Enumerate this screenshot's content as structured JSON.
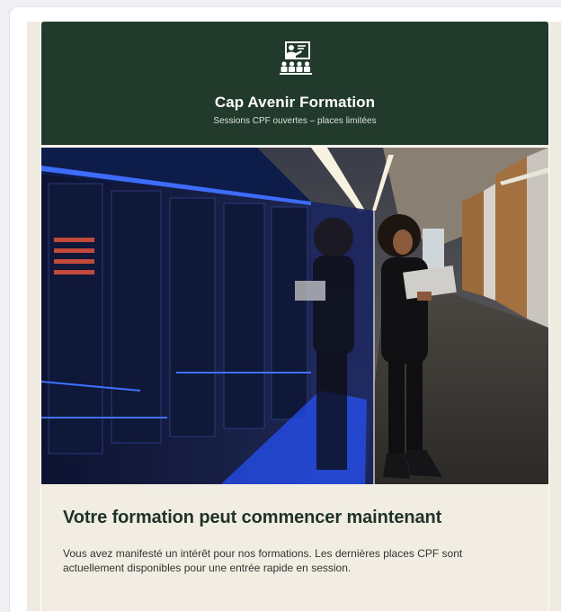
{
  "header": {
    "brand": "Cap Avenir Formation",
    "tagline": "Sessions CPF ouvertes – places limitées",
    "logo_icon": "classroom-presentation-icon",
    "background_color": "#213a2b"
  },
  "hero": {
    "image": "photo-woman-with-laptop-in-server-room"
  },
  "content": {
    "headline": "Votre formation peut commencer maintenant",
    "body": "Vous avez manifesté un intérêt pour nos formations. Les dernières places CPF sont actuellement disponibles pour une entrée rapide en session.",
    "headline_color": "#1f3328"
  }
}
